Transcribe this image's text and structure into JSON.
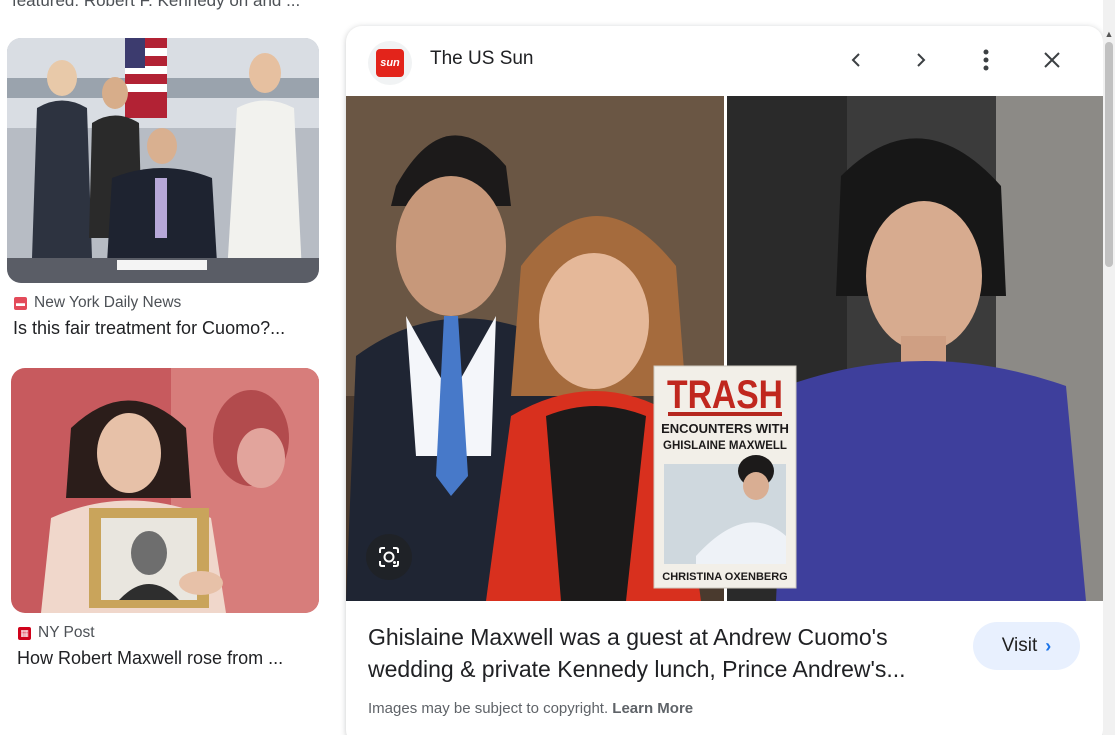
{
  "cut_caption": "featured: Robert F. Kennedy on and ...",
  "results": [
    {
      "source": "New York Daily News",
      "source_icon": "nydn-icon",
      "title": "Is this fair treatment for Cuomo?..."
    },
    {
      "source": "NY Post",
      "source_icon": "nypost-icon",
      "title": "How Robert Maxwell rose from ..."
    }
  ],
  "preview": {
    "logo_text": "sun",
    "source_name": "The US Sun",
    "book_title": "TRASH",
    "book_subtitle_1": "ENCOUNTERS WITH",
    "book_subtitle_2": "GHISLAINE MAXWELL",
    "book_author": "CHRISTINA OXENBERG",
    "caption": "Ghislaine Maxwell was a guest at Andrew Cuomo's wedding & private Kennedy lunch, Prince Andrew's...",
    "visit_label": "Visit",
    "copyright_text": "Images may be subject to copyright.",
    "learn_more": "Learn More"
  },
  "colors": {
    "sun_red": "#e3241b",
    "visit_bg": "#e8f0fe",
    "link_blue": "#1a73e8"
  }
}
